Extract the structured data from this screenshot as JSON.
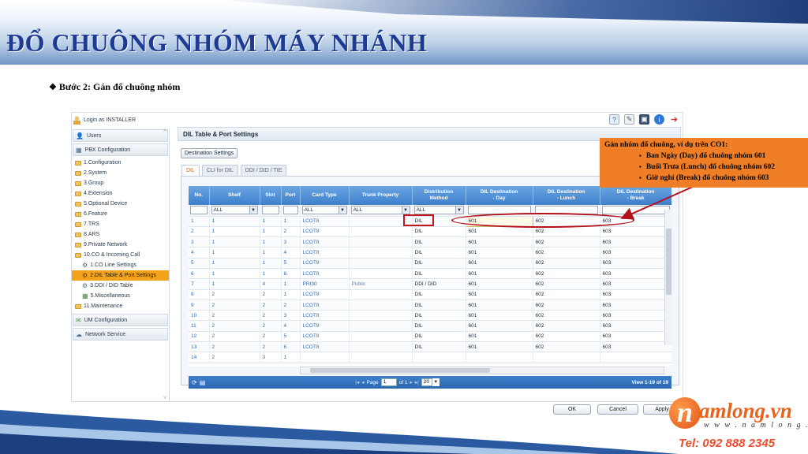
{
  "slide": {
    "title": "ĐỔ CHUÔNG NHÓM MÁY NHÁNH",
    "step": "Bước 2: Gán đổ chuông nhóm"
  },
  "app": {
    "login": "Login as INSTALLER",
    "sidebar": {
      "sections": [
        {
          "label": "Users"
        },
        {
          "label": "PBX Configuration"
        }
      ],
      "items": [
        {
          "label": "1.Configuration"
        },
        {
          "label": "2.System"
        },
        {
          "label": "3.Group"
        },
        {
          "label": "4.Extension"
        },
        {
          "label": "5.Optional Device"
        },
        {
          "label": "6.Feature"
        },
        {
          "label": "7.TRS"
        },
        {
          "label": "8.ARS"
        },
        {
          "label": "9.Private Network"
        },
        {
          "label": "10.CO & Incoming Call"
        },
        {
          "label": "1.CO Line Settings"
        },
        {
          "label": "2.DIL Table & Port Settings"
        },
        {
          "label": "3.DDI / DID Table"
        },
        {
          "label": "5.Miscellaneous"
        },
        {
          "label": "11.Maintenance"
        }
      ],
      "footer_sections": [
        {
          "label": "UM Configuration"
        },
        {
          "label": "Network Service"
        }
      ]
    },
    "main_title": "DIL Table & Port Settings",
    "destination_button": "Destination Settings",
    "tabs": [
      {
        "label": "DIL"
      },
      {
        "label": "CLI for DIL"
      },
      {
        "label": "DDI / DID / TIE"
      }
    ],
    "table": {
      "headers": [
        "No.",
        "Shelf",
        "Slot",
        "Port",
        "Card Type",
        "Trunk Property",
        "Distribution Method",
        "DIL Destination - Day",
        "DIL Destination - Lunch",
        "DIL Destination - Break"
      ],
      "filters": [
        "ALL",
        "ALL",
        "ALL",
        "ALL"
      ],
      "rows": [
        [
          "1",
          "1",
          "1",
          "1",
          "LCOT8",
          "",
          "DIL",
          "601",
          "602",
          "603"
        ],
        [
          "2",
          "1",
          "1",
          "2",
          "LCOT8",
          "",
          "DIL",
          "601",
          "602",
          "603"
        ],
        [
          "3",
          "1",
          "1",
          "3",
          "LCOT8",
          "",
          "DIL",
          "601",
          "602",
          "603"
        ],
        [
          "4",
          "1",
          "1",
          "4",
          "LCOT8",
          "",
          "DIL",
          "601",
          "602",
          "603"
        ],
        [
          "5",
          "1",
          "1",
          "5",
          "LCOT8",
          "",
          "DIL",
          "601",
          "602",
          "603"
        ],
        [
          "6",
          "1",
          "1",
          "6",
          "LCOT8",
          "",
          "DIL",
          "601",
          "602",
          "603"
        ],
        [
          "7",
          "1",
          "4",
          "1",
          "PRI30",
          "Public",
          "DDI / DID",
          "601",
          "602",
          "603"
        ],
        [
          "8",
          "2",
          "2",
          "1",
          "LCOT8",
          "",
          "DIL",
          "601",
          "602",
          "603"
        ],
        [
          "9",
          "2",
          "2",
          "2",
          "LCOT8",
          "",
          "DIL",
          "601",
          "602",
          "603"
        ],
        [
          "10",
          "2",
          "2",
          "3",
          "LCOT8",
          "",
          "DIL",
          "601",
          "602",
          "603"
        ],
        [
          "11",
          "2",
          "2",
          "4",
          "LCOT8",
          "",
          "DIL",
          "601",
          "602",
          "603"
        ],
        [
          "12",
          "2",
          "2",
          "5",
          "LCOT8",
          "",
          "DIL",
          "601",
          "602",
          "603"
        ],
        [
          "13",
          "2",
          "2",
          "6",
          "LCOT8",
          "",
          "DIL",
          "601",
          "602",
          "603"
        ],
        [
          "14",
          "2",
          "3",
          "1",
          "",
          "",
          "",
          "",
          "",
          ""
        ]
      ]
    },
    "pager": {
      "page_label": "Page",
      "page_value": "1",
      "of_label": "of 1",
      "page_size": "20",
      "view": "View 1-19 of 19"
    },
    "buttons": {
      "ok": "OK",
      "cancel": "Cancel",
      "apply": "Apply"
    }
  },
  "annotation": {
    "heading": "Gán nhóm đổ chuông, ví dụ trên CO1:",
    "bullets": [
      "Ban Ngày (Day) đổ chuông nhóm 601",
      "Buổi Trưa (Lunch) đổ chuông nhóm 602",
      "Giờ nghỉ (Break) đổ chuông nhóm 603"
    ]
  },
  "logo": {
    "letter": "n",
    "name": "amlong.vn",
    "website": "w w w . n a m l o n g . v n",
    "tel": "Tel: 092 888 2345"
  },
  "colors": {
    "title": "#1f3a93",
    "header_blue": "#3d7fcc",
    "active_orange": "#f4a21a",
    "note_orange": "#ef7e26",
    "highlight_red": "#c0161e"
  }
}
